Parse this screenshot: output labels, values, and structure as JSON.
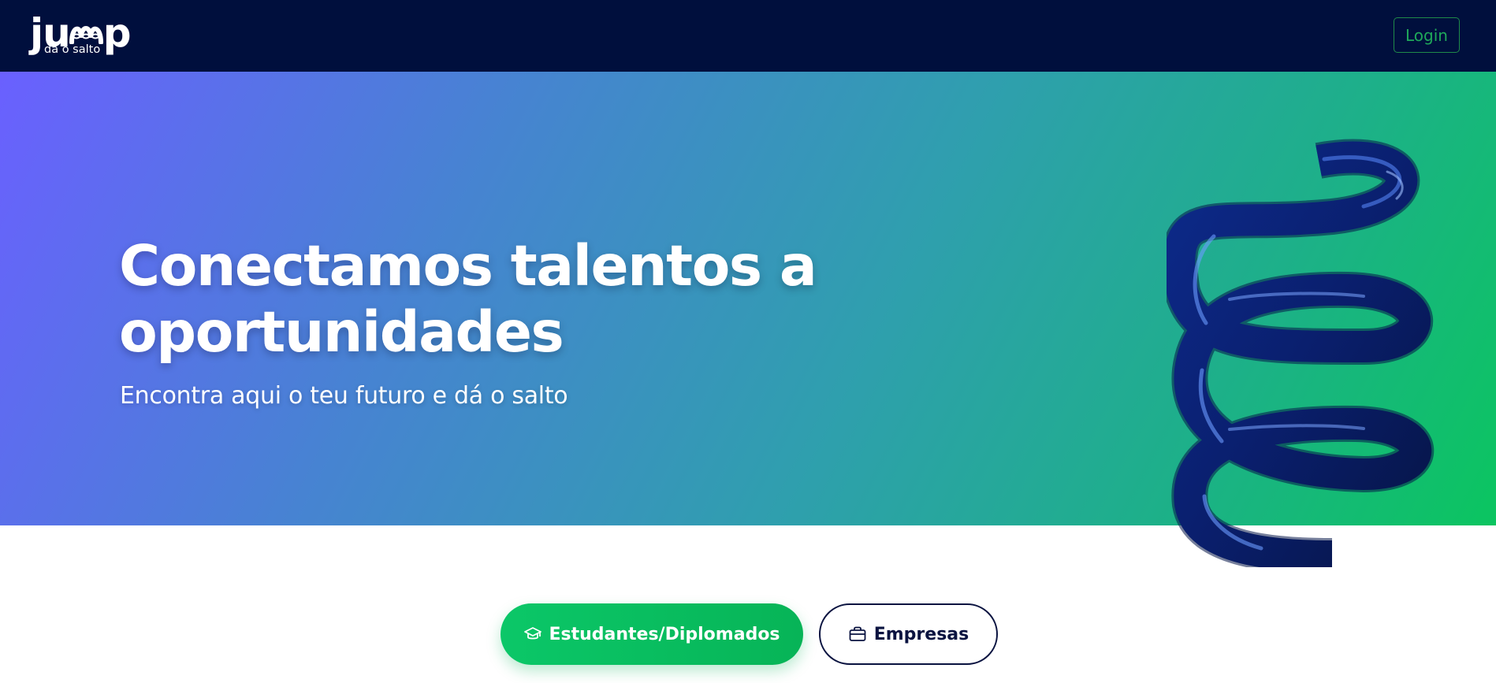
{
  "brand": {
    "logo_tagline": "dá o salto",
    "nav_bg_color": "#000f3d"
  },
  "header": {
    "login_label": "Login",
    "login_color": "#1fa85a"
  },
  "hero": {
    "title": "Conectamos talentos a oportunidades",
    "subtitle": "Encontra aqui o teu futuro e dá o salto",
    "gradient_colors": [
      "#6a60ff",
      "#2f9fae",
      "#0bc560"
    ]
  },
  "cta": {
    "students_label": "Estudantes/Diplomados",
    "students_icon": "graduation-cap-icon",
    "companies_label": "Empresas",
    "companies_icon": "briefcase-icon",
    "accent_color": "#0bc768",
    "dark_color": "#0a1340"
  }
}
